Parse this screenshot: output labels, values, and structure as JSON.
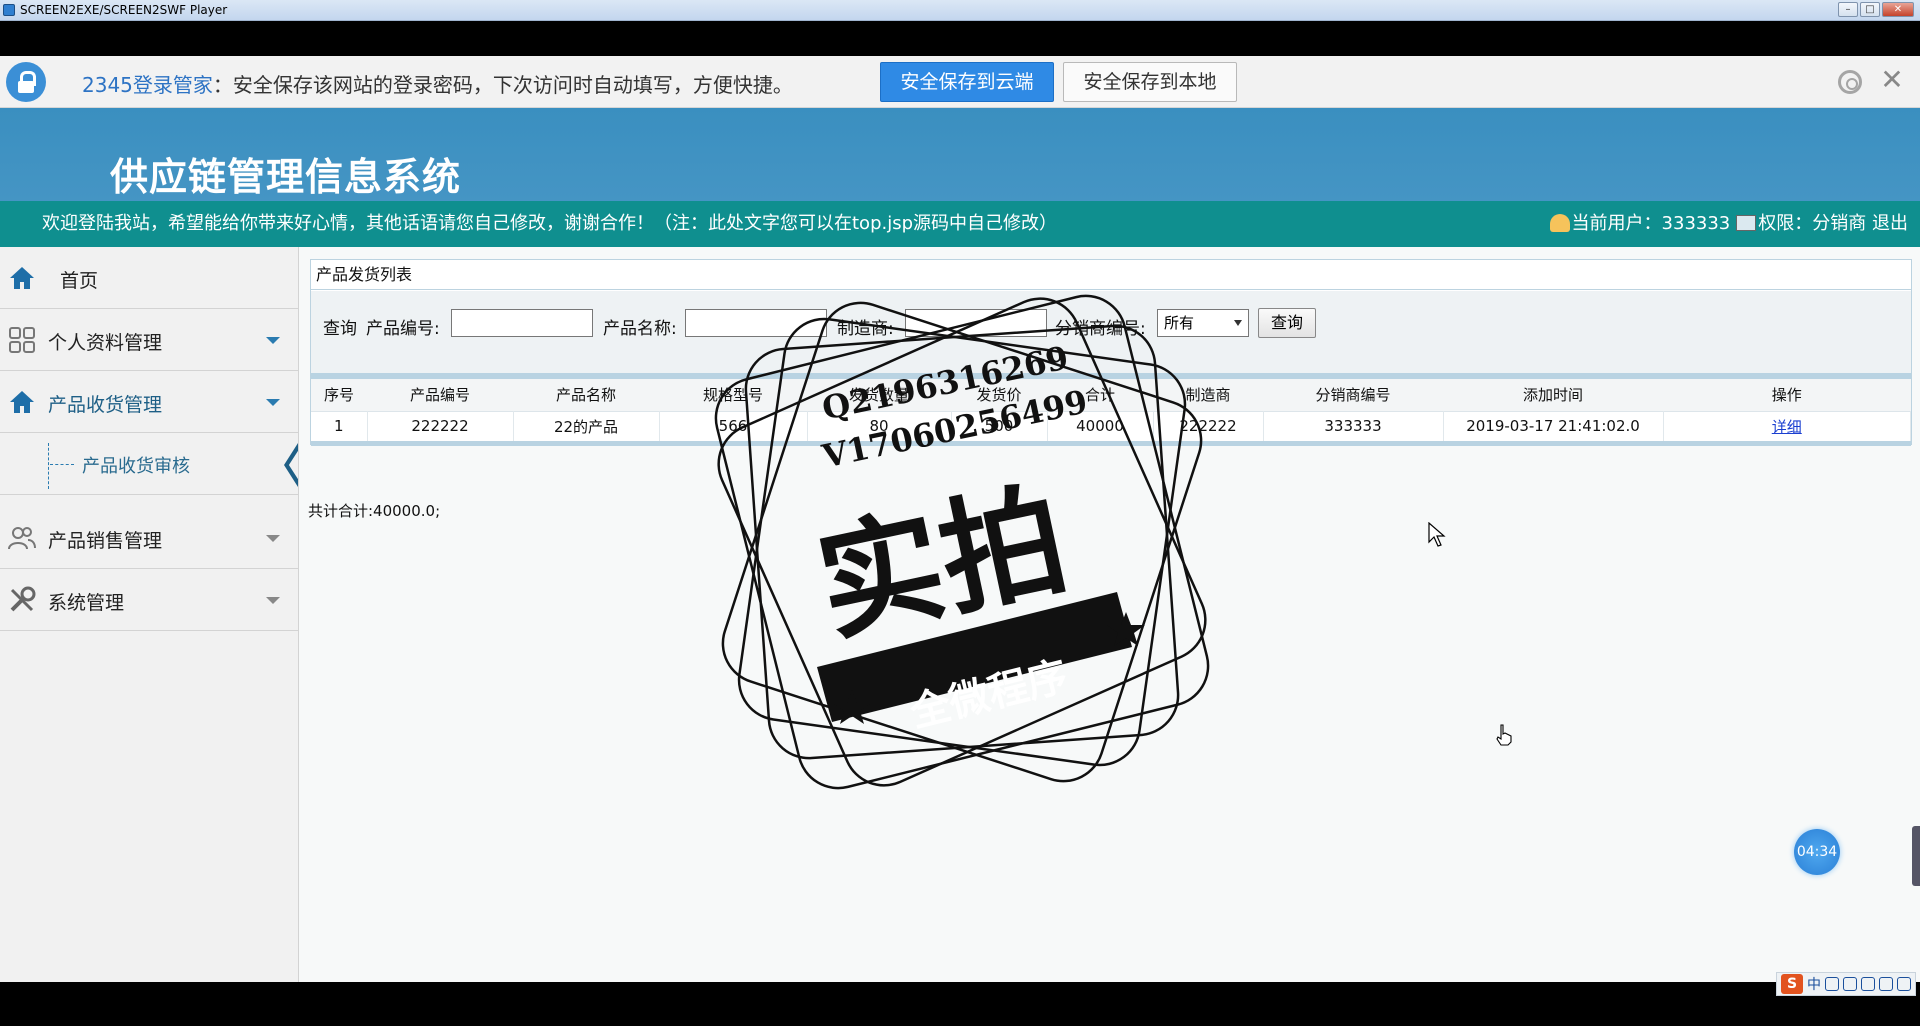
{
  "window": {
    "title": "SCREEN2EXE/SCREEN2SWF Player",
    "buttons": [
      "–",
      "□",
      "✕"
    ]
  },
  "password_bar": {
    "brand": "2345登录管家",
    "message": "：安全保存该网站的登录密码，下次访问时自动填写，方便快捷。",
    "save_cloud": "安全保存到云端",
    "save_local": "安全保存到本地",
    "close": "✕"
  },
  "header": {
    "title": "供应链管理信息系统"
  },
  "welcome": {
    "text": "欢迎登陆我站，希望能给你带来好心情，其他话语请您自己修改，谢谢合作！（注：此处文字您可以在top.jsp源码中自己修改）",
    "current_user_label": "当前用户：333333",
    "permission_label": "权限：分销商",
    "logout": "退出"
  },
  "sidebar": {
    "items": [
      {
        "label": "首页",
        "icon": "home-icon"
      },
      {
        "label": "个人资料管理",
        "icon": "grid-icon"
      },
      {
        "label": "产品收货管理",
        "icon": "home-icon"
      },
      {
        "label": "产品收货审核",
        "icon": "branch-icon"
      },
      {
        "label": "产品销售管理",
        "icon": "users-icon"
      },
      {
        "label": "系统管理",
        "icon": "tools-icon"
      }
    ]
  },
  "panel": {
    "title": "产品发货列表",
    "search": {
      "query_label": "查询",
      "product_code_label": "产品编号:",
      "product_name_label": "产品名称:",
      "manufacturer_label": "制造商:",
      "distributor_label": "分销商编号:",
      "distributor_value": "所有",
      "product_code_value": "",
      "product_name_value": "",
      "manufacturer_value": "",
      "button": "查询"
    },
    "columns": [
      "序号",
      "产品编号",
      "产品名称",
      "规格型号",
      "发货数量",
      "发货价",
      "合计",
      "制造商",
      "分销商编号",
      "添加时间",
      "操作"
    ],
    "rows": [
      [
        "1",
        "222222",
        "22的产品",
        "566",
        "80",
        "500",
        "40000",
        "222222",
        "333333",
        "2019-03-17 21:41:02.0",
        "详细"
      ]
    ],
    "total": "共计合计:40000.0;"
  },
  "watermark": {
    "line1": "Q2196316269",
    "line2": "V17060256499",
    "big": "实拍",
    "banner": "全微程序"
  },
  "overlay": {
    "timer": "04:34"
  },
  "ime": {
    "logo": "S",
    "mode": "中"
  },
  "colors": {
    "header_blue": "#3a8fc0",
    "welcome_teal": "#0f8f8f",
    "cloud_button": "#2f8ae5",
    "link": "#1a3fd0"
  }
}
